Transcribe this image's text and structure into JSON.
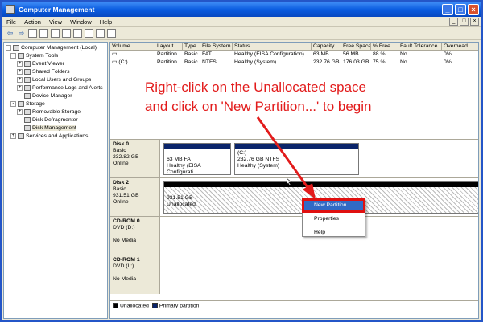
{
  "window": {
    "title": "Computer Management"
  },
  "menu": [
    "File",
    "Action",
    "View",
    "Window",
    "Help"
  ],
  "tree": [
    {
      "label": "Computer Management (Local)",
      "indent": 2,
      "exp": "−"
    },
    {
      "label": "System Tools",
      "indent": 8,
      "exp": "−"
    },
    {
      "label": "Event Viewer",
      "indent": 16,
      "exp": "+"
    },
    {
      "label": "Shared Folders",
      "indent": 16,
      "exp": "+"
    },
    {
      "label": "Local Users and Groups",
      "indent": 16,
      "exp": "+"
    },
    {
      "label": "Performance Logs and Alerts",
      "indent": 16,
      "exp": "+"
    },
    {
      "label": "Device Manager",
      "indent": 25,
      "exp": ""
    },
    {
      "label": "Storage",
      "indent": 8,
      "exp": "−"
    },
    {
      "label": "Removable Storage",
      "indent": 16,
      "exp": "+"
    },
    {
      "label": "Disk Defragmenter",
      "indent": 25,
      "exp": ""
    },
    {
      "label": "Disk Management",
      "indent": 25,
      "exp": "",
      "selected": true
    },
    {
      "label": "Services and Applications",
      "indent": 8,
      "exp": "+"
    }
  ],
  "volumes": {
    "headers": [
      "Volume",
      "Layout",
      "Type",
      "File System",
      "Status",
      "Capacity",
      "Free Space",
      "% Free",
      "Fault Tolerance",
      "Overhead"
    ],
    "rows": [
      [
        "",
        "Partition",
        "Basic",
        "FAT",
        "Healthy (EISA Configuration)",
        "63 MB",
        "56 MB",
        "88 %",
        "No",
        "0%"
      ],
      [
        "(C:)",
        "Partition",
        "Basic",
        "NTFS",
        "Healthy (System)",
        "232.76 GB",
        "176.03 GB",
        "75 %",
        "No",
        "0%"
      ]
    ]
  },
  "disks": [
    {
      "name": "Disk 0",
      "l1": "Basic",
      "l2": "232.82 GB",
      "l3": "Online",
      "parts": [
        {
          "title": "",
          "size": "63 MB FAT",
          "status": "Healthy (EISA Configurati"
        },
        {
          "title": "(C:)",
          "size": "232.76 GB NTFS",
          "status": "Healthy (System)"
        }
      ]
    },
    {
      "name": "Disk 2",
      "l1": "Basic",
      "l2": "931.51 GB",
      "l3": "Online",
      "parts": [
        {
          "title": "",
          "size": "931.51 GB",
          "status": "Unallocated"
        }
      ]
    },
    {
      "name": "CD-ROM 0",
      "l1": "DVD (D:)",
      "l2": "",
      "l3": "No Media"
    },
    {
      "name": "CD-ROM 1",
      "l1": "DVD (L:)",
      "l2": "",
      "l3": "No Media"
    }
  ],
  "legend": {
    "unallocated": "Unallocated",
    "primary": "Primary partition"
  },
  "context_menu": [
    "New Partition...",
    "Properties",
    "Help"
  ],
  "callout": {
    "line1": "Right-click on the Unallocated space",
    "line2": "and click on 'New Partition...' to begin"
  },
  "colors": {
    "callout": "#e21b1b",
    "primary": "#0a246a",
    "highlight": "#316ac5"
  }
}
